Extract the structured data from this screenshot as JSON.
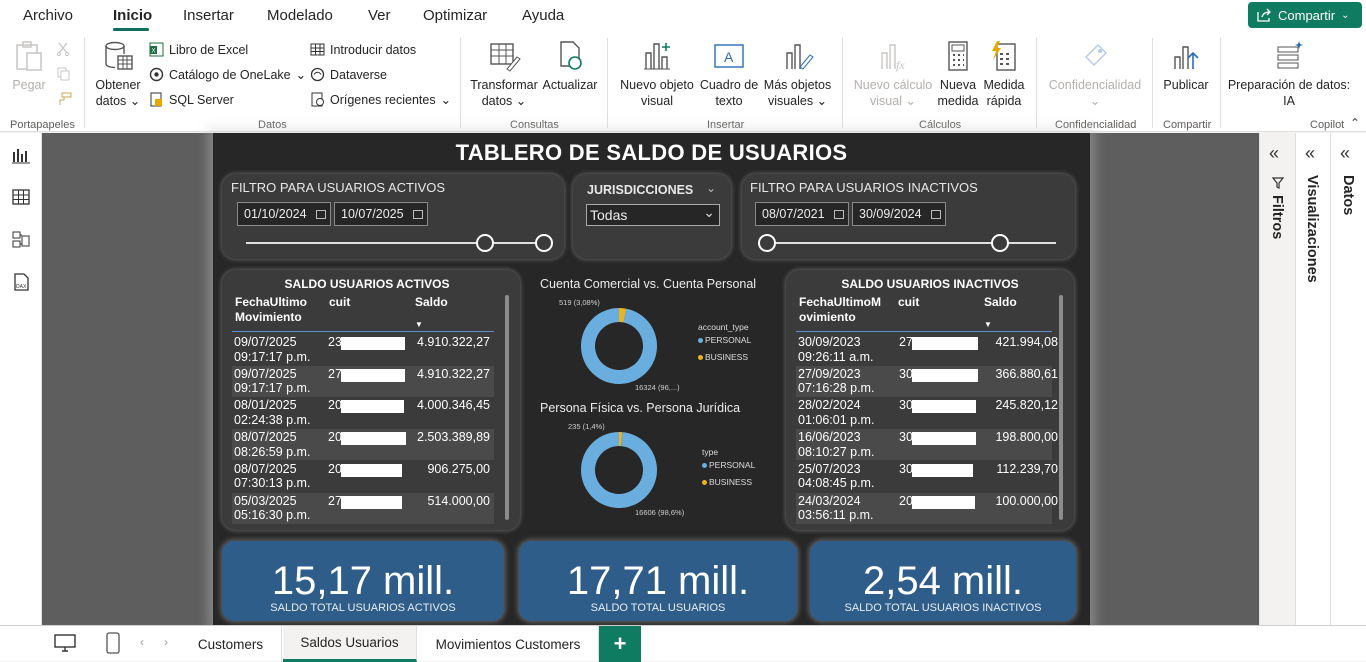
{
  "menu": {
    "tabs": [
      "Archivo",
      "Inicio",
      "Insertar",
      "Modelado",
      "Ver",
      "Optimizar",
      "Ayuda"
    ],
    "share_label": "Compartir"
  },
  "ribbon": {
    "clipboard": {
      "paste": "Pegar",
      "group": "Portapapeles"
    },
    "data": {
      "get_data": "Obtener datos",
      "excel": "Libro de Excel",
      "onelake": "Catálogo de OneLake",
      "sql": "SQL Server",
      "enter_data": "Introducir datos",
      "dataverse": "Dataverse",
      "recent": "Orígenes recientes",
      "group": "Datos"
    },
    "queries": {
      "transform": "Transformar datos",
      "refresh": "Actualizar",
      "group": "Consultas"
    },
    "insert": {
      "new_visual": "Nuevo objeto visual",
      "text_box": "Cuadro de texto",
      "more_visuals": "Más objetos visuales",
      "group": "Insertar"
    },
    "calc": {
      "new_calc": "Nuevo cálculo visual",
      "new_measure": "Nueva medida",
      "quick_measure": "Medida rápida",
      "group": "Cálculos"
    },
    "sensitivity": {
      "label": "Confidencialidad",
      "group": "Confidencialidad"
    },
    "share": {
      "publish": "Publicar",
      "group": "Compartir"
    },
    "copilot": {
      "prep": "Preparación de datos: IA",
      "group": "Copilot"
    }
  },
  "report": {
    "title": "TABLERO DE SALDO DE USUARIOS",
    "filter_active": {
      "label": "FILTRO PARA USUARIOS ACTIVOS",
      "from": "01/10/2024",
      "to": "10/07/2025",
      "range": [
        0.0,
        1.0
      ]
    },
    "jurisdiction": {
      "label": "JURISDICCIONES",
      "value": "Todas"
    },
    "filter_inactive": {
      "label": "FILTRO PARA USUARIOS INACTIVOS",
      "from": "08/07/2021",
      "to": "30/09/2024",
      "range": [
        0.0,
        0.8
      ]
    },
    "active_table": {
      "title": "SALDO USUARIOS ACTIVOS",
      "headers": [
        "FechaUltimo Movimiento",
        "cuit",
        "Saldo"
      ],
      "rows": [
        {
          "date": "09/07/2025",
          "time": "09:17:17 p.m.",
          "cuit": "23",
          "saldo": "4.910.322,27"
        },
        {
          "date": "09/07/2025",
          "time": "09:17:17 p.m.",
          "cuit": "27",
          "saldo": "4.910.322,27"
        },
        {
          "date": "08/01/2025",
          "time": "02:24:38 p.m.",
          "cuit": "20",
          "saldo": "4.000.346,45"
        },
        {
          "date": "08/07/2025",
          "time": "08:26:59 p.m.",
          "cuit": "20",
          "saldo": "2.503.389,89"
        },
        {
          "date": "08/07/2025",
          "time": "07:30:13 p.m.",
          "cuit": "20",
          "saldo": "906.275,00"
        },
        {
          "date": "05/03/2025",
          "time": "05:16:30 p.m.",
          "cuit": "27",
          "saldo": "514.000,00"
        }
      ]
    },
    "inactive_table": {
      "title": "SALDO USUARIOS INACTIVOS",
      "headers": [
        "FechaUltimoM ovimiento",
        "cuit",
        "Saldo"
      ],
      "rows": [
        {
          "date": "30/09/2023",
          "time": "09:26:11 a.m.",
          "cuit": "27",
          "saldo": "421.994,08"
        },
        {
          "date": "27/09/2023",
          "time": "07:16:28 p.m.",
          "cuit": "30",
          "saldo": "366.880,61"
        },
        {
          "date": "28/02/2024",
          "time": "01:06:01 p.m.",
          "cuit": "30",
          "saldo": "245.820,12"
        },
        {
          "date": "16/06/2023",
          "time": "08:10:27 p.m.",
          "cuit": "30",
          "saldo": "198.800,00"
        },
        {
          "date": "25/07/2023",
          "time": "04:08:45 p.m.",
          "cuit": "30",
          "saldo": "112.239,70"
        },
        {
          "date": "24/03/2024",
          "time": "03:56:11 p.m.",
          "cuit": "20",
          "saldo": "100.000,00"
        }
      ]
    },
    "kpis": [
      {
        "value": "15,17 mill.",
        "label": "SALDO TOTAL USUARIOS ACTIVOS"
      },
      {
        "value": "17,71 mill.",
        "label": "SALDO TOTAL USUARIOS"
      },
      {
        "value": "2,54 mill.",
        "label": "SALDO TOTAL USUARIOS INACTIVOS"
      }
    ]
  },
  "chart_data": [
    {
      "type": "pie",
      "title": "Cuenta Comercial vs. Cuenta Personal",
      "legend_title": "account_type",
      "categories": [
        "PERSONAL",
        "BUSINESS"
      ],
      "values": [
        16324,
        519
      ],
      "data_labels": [
        "16324 (96,...)",
        "519 (3,08%)"
      ],
      "colors": [
        "#6aaee0",
        "#e8b422"
      ],
      "legend_position": "right"
    },
    {
      "type": "pie",
      "title": "Persona Física vs. Persona Jurídica",
      "legend_title": "type",
      "categories": [
        "PERSONAL",
        "BUSINESS"
      ],
      "values": [
        16606,
        235
      ],
      "data_labels": [
        "16606 (98,6%)",
        "235 (1,4%)"
      ],
      "colors": [
        "#6aaee0",
        "#e8b422"
      ],
      "legend_position": "right"
    }
  ],
  "panes": {
    "filters": "Filtros",
    "visualizations": "Visualizaciones",
    "data": "Datos"
  },
  "pages": {
    "tabs": [
      "Customers",
      "Saldos Usuarios",
      "Movimientos Customers"
    ],
    "active": "Saldos Usuarios",
    "add": "+"
  }
}
